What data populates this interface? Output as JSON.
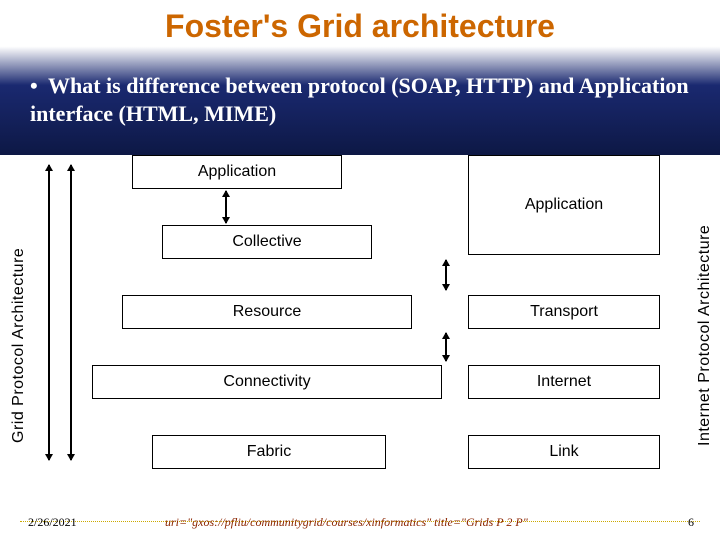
{
  "title": "Foster's Grid architecture",
  "bullet": "What is difference between protocol (SOAP, HTTP) and Application interface (HTML, MIME)",
  "left_label": "Grid Protocol Architecture",
  "right_label": "Internet Protocol Architecture",
  "left_boxes": {
    "application": "Application",
    "collective": "Collective",
    "resource": "Resource",
    "connectivity": "Connectivity",
    "fabric": "Fabric"
  },
  "right_boxes": {
    "application": "Application",
    "transport": "Transport",
    "internet": "Internet",
    "link": "Link"
  },
  "footer": {
    "date": "2/26/2021",
    "uri": "uri=\"gxos://pfliu/communitygrid/courses/xinformatics\" title=\"Grids P 2 P\"",
    "page": "6"
  }
}
